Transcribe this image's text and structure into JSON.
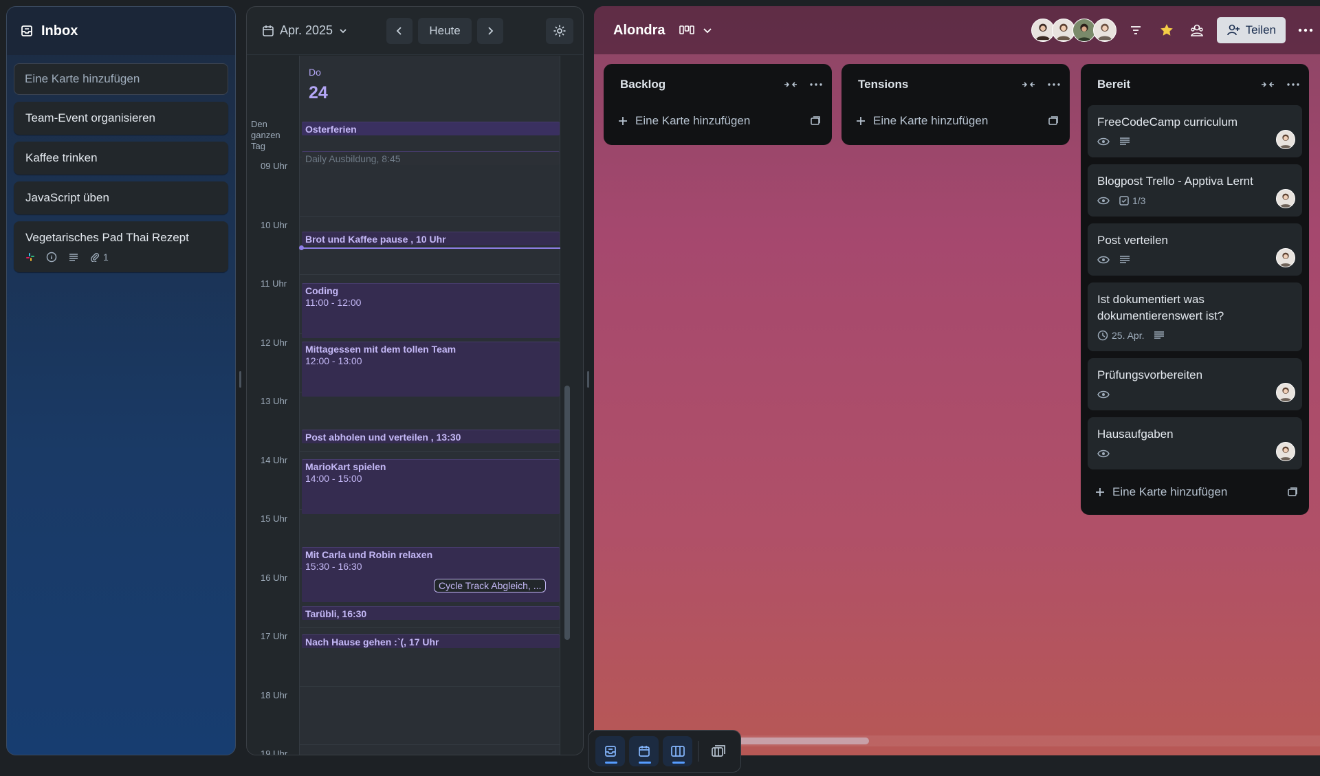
{
  "inbox": {
    "title": "Inbox",
    "add_card": "Eine Karte hinzufügen",
    "cards": [
      {
        "title": "Team-Event organisieren"
      },
      {
        "title": "Kaffee trinken"
      },
      {
        "title": "JavaScript üben"
      },
      {
        "title": "Vegetarisches Pad Thai Rezept",
        "attachments": "1"
      }
    ]
  },
  "calendar": {
    "month": "Apr. 2025",
    "today": "Heute",
    "day_of_week": "Do",
    "day_number": "24",
    "all_day_label": "Den ganzen Tag",
    "hours": [
      "09 Uhr",
      "10 Uhr",
      "11 Uhr",
      "12 Uhr",
      "13 Uhr",
      "14 Uhr",
      "15 Uhr",
      "16 Uhr",
      "17 Uhr",
      "18 Uhr",
      "19 Uhr"
    ],
    "all_day_event": "Osterferien",
    "events": {
      "daily": "Daily Ausbildung, 8:45",
      "brot": "Brot und Kaffee pause , 10 Uhr",
      "coding": "Coding",
      "coding_time": "11:00 - 12:00",
      "mittag": "Mittagessen mit dem tollen Team",
      "mittag_time": "12:00 - 13:00",
      "post": "Post abholen und verteilen , 13:30",
      "mario": "MarioKart spielen",
      "mario_time": "14:00 - 15:00",
      "carla": "Mit Carla und Robin relaxen",
      "carla_time": "15:30 - 16:30",
      "cycle": "Cycle Track Abgleich, ...",
      "tarubli": "Tarübli, 16:30",
      "hause": "Nach Hause gehen :`(, 17 Uhr"
    }
  },
  "board": {
    "title": "Alondra",
    "share": "Teilen",
    "lists": [
      {
        "title": "Backlog",
        "add": "Eine Karte hinzufügen"
      },
      {
        "title": "Tensions",
        "add": "Eine Karte hinzufügen"
      },
      {
        "title": "Bereit",
        "add": "Eine Karte hinzufügen",
        "cards": [
          {
            "title": "FreeCodeCamp curriculum"
          },
          {
            "title": "Blogpost Trello - Apptiva Lernt",
            "checklist": "1/3"
          },
          {
            "title": "Post verteilen"
          },
          {
            "title": "Ist dokumentiert was dokumentierenswert ist?",
            "due": "25. Apr."
          },
          {
            "title": "Prüfungsvorbereiten"
          },
          {
            "title": "Hausaufgaben"
          }
        ]
      }
    ]
  },
  "colors": {
    "accent": "#579dff",
    "calendar_event": "#352c50",
    "now_line": "#8f7ee7"
  }
}
